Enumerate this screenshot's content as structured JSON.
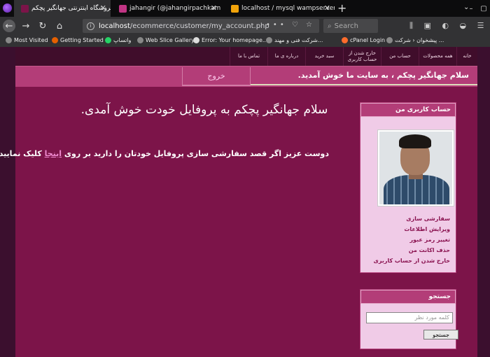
{
  "browser": {
    "tabs": [
      {
        "title": "فروشگاه اینترنتی جهانگیر پچکم",
        "fav_color": "#7c1449",
        "active": true
      },
      {
        "title": "jahangir (@jahangirpachkam) • Ins",
        "fav_color": "#c13584",
        "active": false
      },
      {
        "title": "localhost / mysql wampserver / ec",
        "fav_color": "#f0a30a",
        "active": false
      }
    ],
    "url_host": "localhost",
    "url_path": "/ecommerce/customer/my_account.php",
    "search_placeholder": "Search",
    "bookmarks": [
      "Most Visited",
      "Getting Started",
      "واتساپ",
      "Web Slice Gallery",
      "Error: Your homepage...",
      "شرکت فنی و مهند...",
      "cPanel Login",
      "پیشخوان ‹ شرکت ..."
    ]
  },
  "site": {
    "menu": [
      "خانه",
      "همه محصولات",
      "حساب من",
      "خارج شدن از حساب کاربری",
      "سبد خرید",
      "درباره ی ما",
      "تماس با ما"
    ],
    "welcome": "سلام جهانگیر پچکم ، به سایت ما خوش آمدید.",
    "logout": "خروج",
    "greeting": "سلام جهانگیر پچکم به پروفایل خودت خوش آمدی.",
    "note_before": "دوست عزیز اگر قصد سفارشی سازی پروفایل خودتان را دارید بر روی ",
    "note_link": "اینجا",
    "note_after": " کلیک نمایید.",
    "profile_box_title": "حساب کاربری من",
    "profile_links": [
      "سفارشی سازی",
      "ویرایش اطلاعات",
      "تغییر رمز عبور",
      "حذف اکانت من",
      "خارج شدن از حساب کاربری"
    ],
    "search_box_title": "جستجو",
    "search_placeholder": "کلمه مورد نظر",
    "search_button": "جستجو"
  }
}
